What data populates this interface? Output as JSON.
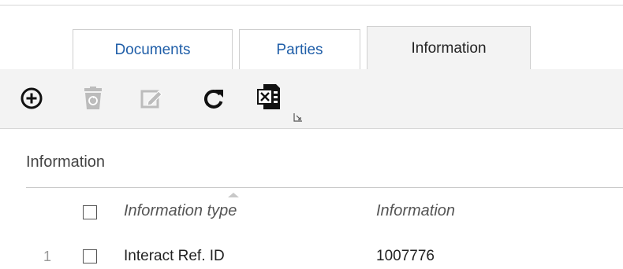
{
  "tabs": [
    {
      "label": "Documents",
      "active": false
    },
    {
      "label": "Parties",
      "active": false
    },
    {
      "label": "Information",
      "active": true
    }
  ],
  "toolbar": {
    "icons": [
      "add-circle-icon",
      "recycle-bin-icon",
      "edit-icon",
      "refresh-icon",
      "excel-export-icon",
      "expand-icon"
    ],
    "disabled": [
      "recycle-bin-icon",
      "edit-icon"
    ]
  },
  "section": {
    "title": "Information"
  },
  "table": {
    "columns": [
      "Information type",
      "Information"
    ],
    "sorted_column": "Information type",
    "rows": [
      {
        "number": "1",
        "type": "Interact Ref. ID",
        "information": "1007776"
      }
    ]
  },
  "colors": {
    "tab_link": "#1f5ea8",
    "toolbar_bg": "#f3f3f3",
    "disabled_icon": "#bcbcbc",
    "text": "#222222"
  }
}
